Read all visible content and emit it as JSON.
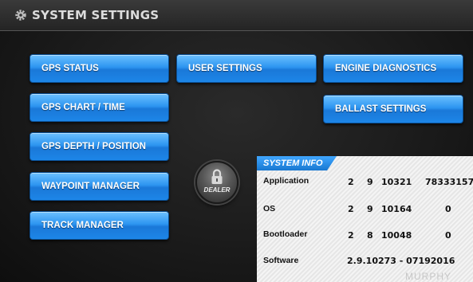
{
  "header": {
    "title": "SYSTEM SETTINGS",
    "icon": "gear-icon"
  },
  "buttons": {
    "gps_status": "GPS STATUS",
    "gps_chart_time": "GPS CHART / TIME",
    "gps_depth_position": "GPS DEPTH / POSITION",
    "waypoint_manager": "WAYPOINT MANAGER",
    "track_manager": "TRACK MANAGER",
    "user_settings": "USER SETTINGS",
    "engine_diagnostics": "ENGINE DIAGNOSTICS",
    "ballast_settings": "BALLAST SETTINGS"
  },
  "dealer": {
    "label": "DEALER",
    "icon": "padlock-icon"
  },
  "system_info": {
    "title": "SYSTEM INFO",
    "rows": [
      {
        "label": "Application",
        "v1": "2",
        "v2": "9",
        "v3": "10321",
        "v4": "78333157"
      },
      {
        "label": "OS",
        "v1": "2",
        "v2": "9",
        "v3": "10164",
        "v4": "0"
      },
      {
        "label": "Bootloader",
        "v1": "2",
        "v2": "8",
        "v3": "10048",
        "v4": "0"
      }
    ],
    "software_label": "Software",
    "software_value": "2.9.10273 - 07192016"
  },
  "brand": {
    "logo_text": "MURPHY"
  },
  "colors": {
    "button_blue": "#2d95f0",
    "title_bar": "#2e2e2e",
    "tab_blue": "#1877d0"
  }
}
